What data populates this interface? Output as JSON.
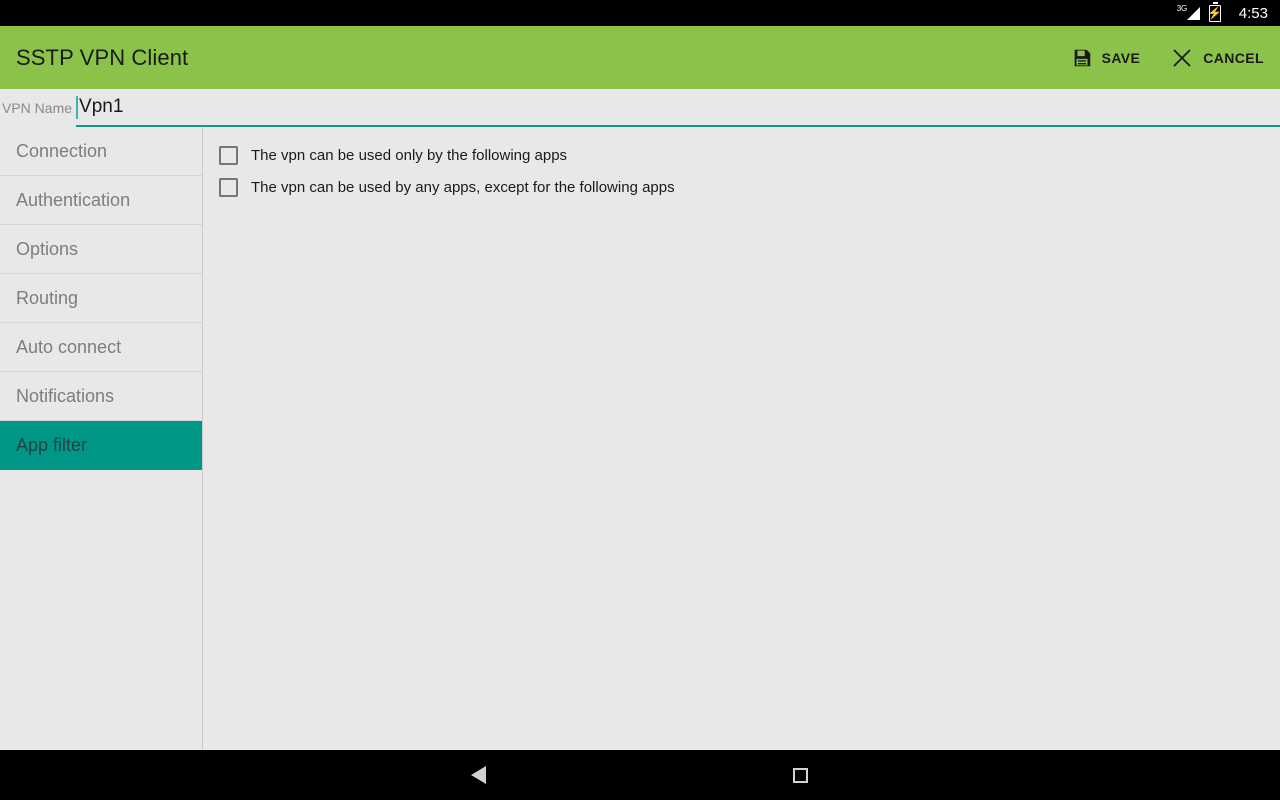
{
  "status_bar": {
    "network_label": "3G",
    "time": "4:53",
    "signal_icon": "signal-3g-icon",
    "battery_icon": "battery-charging-icon"
  },
  "app_bar": {
    "title": "SSTP VPN Client",
    "background_color": "#8BC34A",
    "actions": [
      {
        "label": "SAVE",
        "icon": "save-floppy-icon"
      },
      {
        "label": "CANCEL",
        "icon": "close-x-icon"
      }
    ]
  },
  "name_field": {
    "label": "VPN Name",
    "value": "Vpn1",
    "placeholder": "VPN Name",
    "accent_color": "#179588"
  },
  "sidebar": {
    "items": [
      {
        "label": "Connection",
        "selected": false
      },
      {
        "label": "Authentication",
        "selected": false
      },
      {
        "label": "Options",
        "selected": false
      },
      {
        "label": "Routing",
        "selected": false
      },
      {
        "label": "Auto connect",
        "selected": false
      },
      {
        "label": "Notifications",
        "selected": false
      },
      {
        "label": "App filter",
        "selected": true
      }
    ],
    "selected_color": "#009688"
  },
  "app_filter_pane": {
    "checkboxes": [
      {
        "label": "The vpn can be used only by the following apps",
        "checked": false
      },
      {
        "label": "The vpn can be used by any apps, except for the following apps",
        "checked": false
      }
    ]
  },
  "nav_bar": {
    "back_icon": "back-triangle-icon",
    "recents_icon": "recents-square-icon"
  }
}
